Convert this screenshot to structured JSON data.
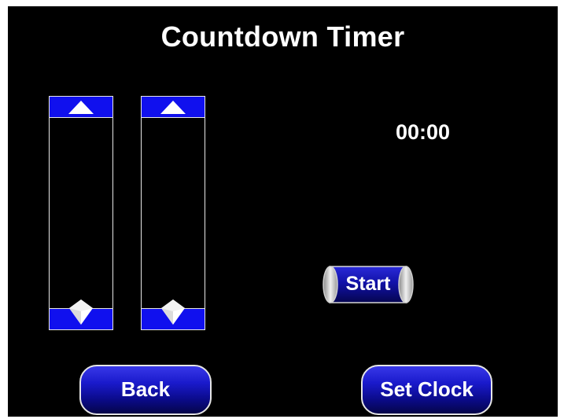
{
  "screen": {
    "title": "Countdown Timer",
    "background_color": "#000000",
    "accent_color": "#1010ee"
  },
  "sliders": [
    {
      "name": "minutes",
      "up_icon": "triangle-up-icon",
      "thumb_icon": "diamond-thumb-icon",
      "value": 0
    },
    {
      "name": "seconds",
      "up_icon": "triangle-up-icon",
      "thumb_icon": "diamond-thumb-icon",
      "value": 0
    }
  ],
  "timer": {
    "display": "00:00"
  },
  "buttons": {
    "start_label": "Start",
    "back_label": "Back",
    "set_clock_label": "Set Clock"
  }
}
